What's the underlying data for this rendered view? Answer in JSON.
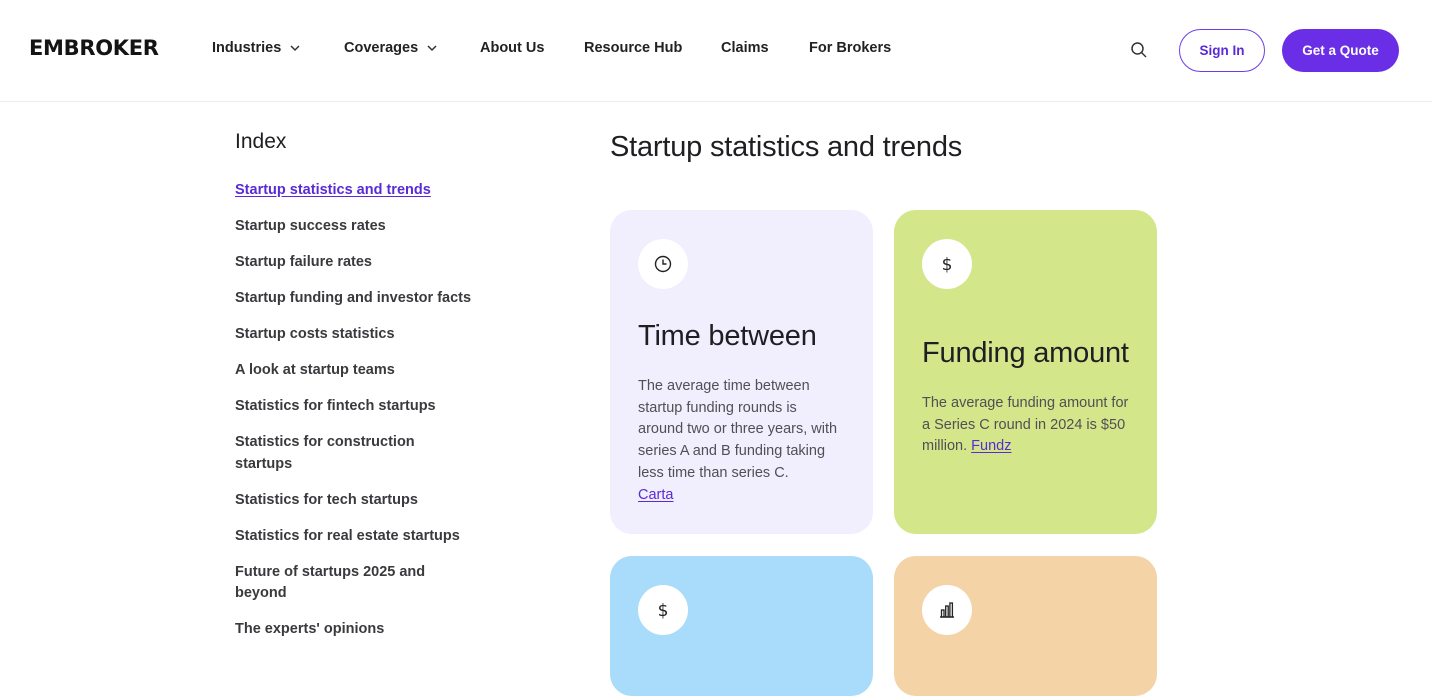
{
  "brand": {
    "logo": "EMBROKER"
  },
  "nav": {
    "items": [
      {
        "label": "Industries",
        "has_dropdown": true
      },
      {
        "label": "Coverages",
        "has_dropdown": true
      },
      {
        "label": "About Us",
        "has_dropdown": false
      },
      {
        "label": "Resource Hub",
        "has_dropdown": false
      },
      {
        "label": "Claims",
        "has_dropdown": false
      },
      {
        "label": "For Brokers",
        "has_dropdown": false
      }
    ],
    "search_icon": "search-icon",
    "sign_in": "Sign In",
    "get_quote": "Get a Quote"
  },
  "sidebar": {
    "title": "Index",
    "items": [
      {
        "label": "Startup statistics and trends",
        "active": true
      },
      {
        "label": "Startup success rates"
      },
      {
        "label": "Startup failure rates"
      },
      {
        "label": "Startup funding and investor facts"
      },
      {
        "label": "Startup costs statistics"
      },
      {
        "label": "A look at startup teams"
      },
      {
        "label": "Statistics for fintech startups"
      },
      {
        "label": "Statistics for construction startups"
      },
      {
        "label": "Statistics for tech startups"
      },
      {
        "label": "Statistics for real estate startups"
      },
      {
        "label": "Future of startups 2025 and beyond"
      },
      {
        "label": "The experts' opinions"
      }
    ]
  },
  "main": {
    "title": "Startup statistics and trends",
    "cards": [
      {
        "icon": "clock-icon",
        "title": "Time between",
        "body": "The average time between startup funding rounds is around two or three years, with series A and B funding taking less time than series C.",
        "source": "Carta",
        "bg": "#f1eefd"
      },
      {
        "icon": "dollar-icon",
        "title": "Funding amount",
        "body": "The average funding amount for a Series C round in 2024 is $50 million.",
        "source": "Fundz",
        "bg": "#d3e68a"
      },
      {
        "icon": "dollar-icon",
        "bg": "#a8dcfa"
      },
      {
        "icon": "bar-chart-icon",
        "bg": "#f4d3a6"
      }
    ]
  },
  "colors": {
    "accent": "#6a2ee6",
    "link": "#5a2ad6"
  }
}
